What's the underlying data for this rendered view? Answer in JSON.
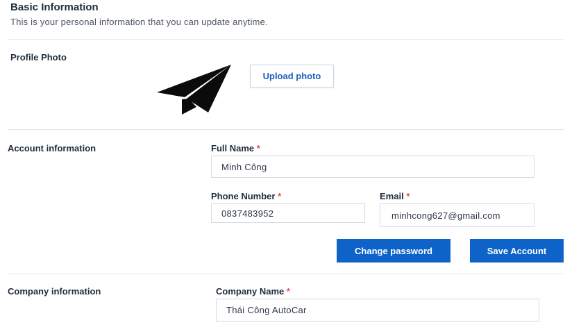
{
  "header": {
    "title": "Basic Information",
    "subtitle": "This is your personal information that you can update anytime."
  },
  "profile_photo": {
    "label": "Profile Photo",
    "icon": "paper-plane-icon",
    "upload_label": "Upload photo"
  },
  "account": {
    "section_label": "Account information",
    "full_name_label": "Full Name",
    "full_name_value": "Minh Công",
    "phone_label": "Phone Number",
    "phone_value": "0837483952",
    "email_label": "Email",
    "email_value": "minhcong627@gmail.com",
    "required_mark": "*",
    "change_password_label": "Change password",
    "save_label": "Save Account"
  },
  "company": {
    "section_label": "Company information",
    "company_name_label": "Company Name",
    "company_name_value": "Thái Công AutoCar",
    "required_mark": "*"
  },
  "colors": {
    "primary": "#0e63c9",
    "required": "#e5484d",
    "divider": "#e3e6ea"
  }
}
